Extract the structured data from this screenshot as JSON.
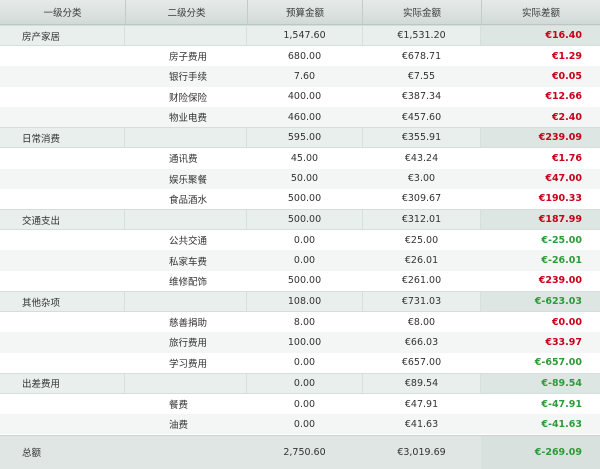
{
  "table": {
    "headers": [
      "一级分类",
      "二级分类",
      "预算金额",
      "实际金额",
      "实际差额"
    ],
    "rows": [
      {
        "type": "group",
        "cat1": "房产家居",
        "cat2": "",
        "budget": "1,547.60",
        "actual": "€1,531.20",
        "diff": "€16.40",
        "status": "over"
      },
      {
        "type": "sub",
        "cat1": "",
        "cat2": "房子费用",
        "budget": "680.00",
        "actual": "€678.71",
        "diff": "€1.29",
        "status": "over"
      },
      {
        "type": "sub",
        "cat1": "",
        "cat2": "银行手续",
        "budget": "7.60",
        "actual": "€7.55",
        "diff": "€0.05",
        "status": "over"
      },
      {
        "type": "sub",
        "cat1": "",
        "cat2": "财险保险",
        "budget": "400.00",
        "actual": "€387.34",
        "diff": "€12.66",
        "status": "over"
      },
      {
        "type": "sub",
        "cat1": "",
        "cat2": "物业电费",
        "budget": "460.00",
        "actual": "€457.60",
        "diff": "€2.40",
        "status": "over"
      },
      {
        "type": "group",
        "cat1": "日常消费",
        "cat2": "",
        "budget": "595.00",
        "actual": "€355.91",
        "diff": "€239.09",
        "status": "over"
      },
      {
        "type": "sub",
        "cat1": "",
        "cat2": "通讯费",
        "budget": "45.00",
        "actual": "€43.24",
        "diff": "€1.76",
        "status": "over"
      },
      {
        "type": "sub",
        "cat1": "",
        "cat2": "娱乐聚餐",
        "budget": "50.00",
        "actual": "€3.00",
        "diff": "€47.00",
        "status": "over"
      },
      {
        "type": "sub",
        "cat1": "",
        "cat2": "食品酒水",
        "budget": "500.00",
        "actual": "€309.67",
        "diff": "€190.33",
        "status": "over"
      },
      {
        "type": "group",
        "cat1": "交通支出",
        "cat2": "",
        "budget": "500.00",
        "actual": "€312.01",
        "diff": "€187.99",
        "status": "over"
      },
      {
        "type": "sub",
        "cat1": "",
        "cat2": "公共交通",
        "budget": "0.00",
        "actual": "€25.00",
        "diff": "€-25.00",
        "status": "under"
      },
      {
        "type": "sub",
        "cat1": "",
        "cat2": "私家车费",
        "budget": "0.00",
        "actual": "€26.01",
        "diff": "€-26.01",
        "status": "under"
      },
      {
        "type": "sub",
        "cat1": "",
        "cat2": "维修配饰",
        "budget": "500.00",
        "actual": "€261.00",
        "diff": "€239.00",
        "status": "over"
      },
      {
        "type": "group",
        "cat1": "其他杂项",
        "cat2": "",
        "budget": "108.00",
        "actual": "€731.03",
        "diff": "€-623.03",
        "status": "under"
      },
      {
        "type": "sub",
        "cat1": "",
        "cat2": "慈善捐助",
        "budget": "8.00",
        "actual": "€8.00",
        "diff": "€0.00",
        "status": "over"
      },
      {
        "type": "sub",
        "cat1": "",
        "cat2": "旅行费用",
        "budget": "100.00",
        "actual": "€66.03",
        "diff": "€33.97",
        "status": "over"
      },
      {
        "type": "sub",
        "cat1": "",
        "cat2": "学习费用",
        "budget": "0.00",
        "actual": "€657.00",
        "diff": "€-657.00",
        "status": "under"
      },
      {
        "type": "group",
        "cat1": "出差费用",
        "cat2": "",
        "budget": "0.00",
        "actual": "€89.54",
        "diff": "€-89.54",
        "status": "under"
      },
      {
        "type": "sub",
        "cat1": "",
        "cat2": "餐费",
        "budget": "0.00",
        "actual": "€47.91",
        "diff": "€-47.91",
        "status": "under"
      },
      {
        "type": "sub",
        "cat1": "",
        "cat2": "油费",
        "budget": "0.00",
        "actual": "€41.63",
        "diff": "€-41.63",
        "status": "under"
      },
      {
        "type": "total",
        "cat1": "总额",
        "cat2": "",
        "budget": "2,750.60",
        "actual": "€3,019.69",
        "diff": "€-269.09",
        "status": "under"
      }
    ]
  },
  "colors": {
    "over_budget_text": "#c8001a",
    "under_budget_text": "#2e9a3a",
    "header_background": "#d8dfdc",
    "group_row_background": "#e9efed"
  }
}
